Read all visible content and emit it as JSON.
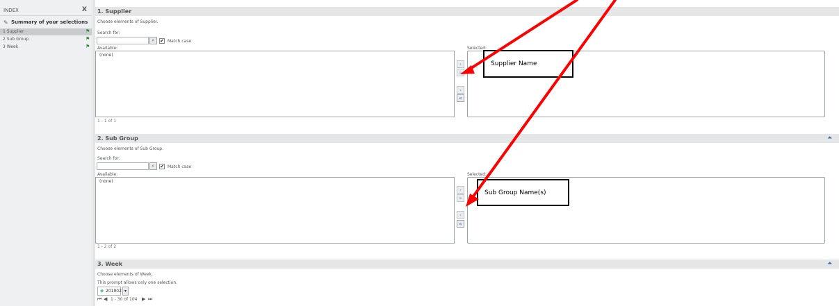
{
  "sidebar": {
    "title": "INDEX",
    "close": "X",
    "summary_label": "Summary of your selections",
    "items": [
      {
        "num": "1",
        "label": "Supplier"
      },
      {
        "num": "2",
        "label": "Sub Group"
      },
      {
        "num": "3",
        "label": "Week"
      }
    ]
  },
  "supplier": {
    "title": "1. Supplier",
    "instruction": "Choose elements of Supplier.",
    "search_label": "Search for:",
    "match_case": "Match case",
    "available_label": "Available:",
    "selected_label": "Selected:",
    "available_items": [
      "(none)"
    ],
    "count": "1 - 1 of 1",
    "callout": "Supplier Name"
  },
  "subgroup": {
    "title": "2. Sub Group",
    "instruction": "Choose elements of Sub Group.",
    "search_label": "Search for:",
    "match_case": "Match case",
    "available_label": "Available:",
    "selected_label": "Selected:",
    "available_items": [
      "(none)"
    ],
    "count": "1 - 2 of 2",
    "callout": "Sub Group Name(s)"
  },
  "week": {
    "title": "3. Week",
    "instruction": "Choose elements of Week.",
    "note": "This prompt allows only one selection.",
    "value": "201902",
    "pager": "1 - 30 of 104"
  },
  "icons": {
    "add": "›",
    "remove": "‹",
    "remove_all": "«",
    "collapse": "⏶",
    "flag": "⚑",
    "search": "⌕",
    "check": "✔"
  },
  "colors": {
    "arrow": "#ff0000",
    "flag": "#2e8b2e",
    "accent": "#3a6aa8"
  }
}
